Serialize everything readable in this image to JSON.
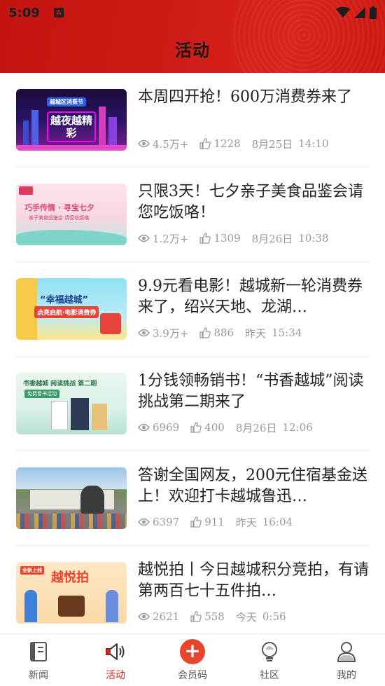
{
  "status_bar": {
    "time": "5:09",
    "a_badge": "A"
  },
  "header": {
    "title": "活动"
  },
  "articles": [
    {
      "title": "本周四开抢！600万消费券来了",
      "views": "4.5万+",
      "likes": "1228",
      "date": "8月25日",
      "time": "14:10",
      "thumb_caption": "越夜越精彩",
      "thumb_badge": "越城区消费节"
    },
    {
      "title": "只限3天！七夕亲子美食品鉴会请您吃饭咯！",
      "views": "1.2万+",
      "likes": "1309",
      "date": "8月26日",
      "time": "10:38",
      "thumb_caption": "巧手传情 · 寻宝七夕",
      "thumb_badge": "亲子美食品鉴会 请您吃饭咯"
    },
    {
      "title": "9.9元看电影！越城新一轮消费券来了，绍兴天地、龙湖…",
      "views": "3.9万+",
      "likes": "886",
      "date": "昨天",
      "time": "15:34",
      "thumb_caption": "“幸福越城”",
      "thumb_badge": "点亮启航·电影消费券"
    },
    {
      "title": "1分钱领畅销书！“书香越城”阅读挑战第二期来了",
      "views": "6969",
      "likes": "400",
      "date": "8月26日",
      "time": "12:06",
      "thumb_caption": "书香越城 阅读挑战 第二期",
      "thumb_badge": "免费看书活动"
    },
    {
      "title": "答谢全国网友，200元住宿基金送上！欢迎打卡越城鲁迅…",
      "views": "6397",
      "likes": "911",
      "date": "昨天",
      "time": "16:04",
      "thumb_caption": "",
      "thumb_badge": ""
    },
    {
      "title": "越悦拍丨今日越城积分竞拍，有请第两百七十五件拍…",
      "views": "2621",
      "likes": "558",
      "date": "今天",
      "time": "0:56",
      "thumb_caption": "越悦拍",
      "thumb_badge": "全新上线"
    }
  ],
  "tabs": [
    {
      "label": "新闻",
      "icon": "news-icon",
      "active": false
    },
    {
      "label": "活动",
      "icon": "megaphone-icon",
      "active": true
    },
    {
      "label": "会员码",
      "icon": "plus-icon",
      "active": false
    },
    {
      "label": "社区",
      "icon": "community-icon",
      "active": false
    },
    {
      "label": "我的",
      "icon": "profile-icon",
      "active": false
    }
  ],
  "colors": {
    "brand_red": "#d8241c",
    "meta_gray": "#9a9a9a"
  }
}
